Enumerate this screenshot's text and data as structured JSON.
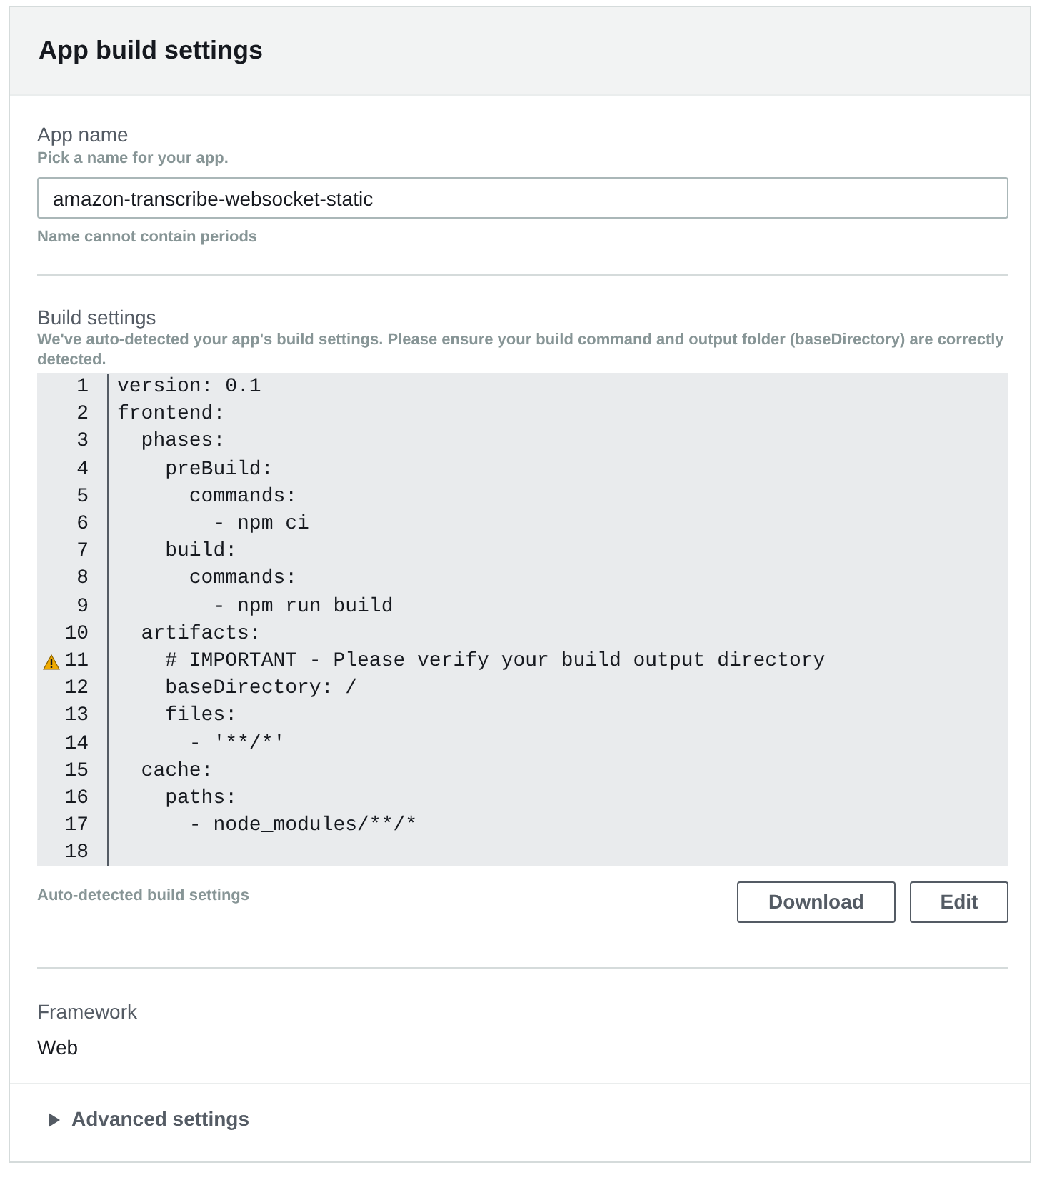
{
  "title": "App build settings",
  "app_name": {
    "label": "App name",
    "description": "Pick a name for your app.",
    "value": "amazon-transcribe-websocket-static",
    "constraint": "Name cannot contain periods"
  },
  "build_settings": {
    "label": "Build settings",
    "description": "We've auto-detected your app's build settings. Please ensure your build command and output folder (baseDirectory) are correctly detected.",
    "code_lines": [
      {
        "number": "1",
        "text": "version: 0.1",
        "warning": false
      },
      {
        "number": "2",
        "text": "frontend:",
        "warning": false
      },
      {
        "number": "3",
        "text": "  phases:",
        "warning": false
      },
      {
        "number": "4",
        "text": "    preBuild:",
        "warning": false
      },
      {
        "number": "5",
        "text": "      commands:",
        "warning": false
      },
      {
        "number": "6",
        "text": "        - npm ci",
        "warning": false
      },
      {
        "number": "7",
        "text": "    build:",
        "warning": false
      },
      {
        "number": "8",
        "text": "      commands:",
        "warning": false
      },
      {
        "number": "9",
        "text": "        - npm run build",
        "warning": false
      },
      {
        "number": "10",
        "text": "  artifacts:",
        "warning": false
      },
      {
        "number": "11",
        "text": "    # IMPORTANT - Please verify your build output directory",
        "warning": true
      },
      {
        "number": "12",
        "text": "    baseDirectory: /",
        "warning": false
      },
      {
        "number": "13",
        "text": "    files:",
        "warning": false
      },
      {
        "number": "14",
        "text": "      - '**/*'",
        "warning": false
      },
      {
        "number": "15",
        "text": "  cache:",
        "warning": false
      },
      {
        "number": "16",
        "text": "    paths:",
        "warning": false
      },
      {
        "number": "17",
        "text": "      - node_modules/**/*",
        "warning": false
      },
      {
        "number": "18",
        "warning": false
      }
    ],
    "footer_note": "Auto-detected build settings",
    "buttons": [
      "Download",
      "Edit"
    ]
  },
  "framework": {
    "label": "Framework",
    "value": "Web"
  },
  "advanced": {
    "label": "Advanced settings",
    "expanded": false
  }
}
